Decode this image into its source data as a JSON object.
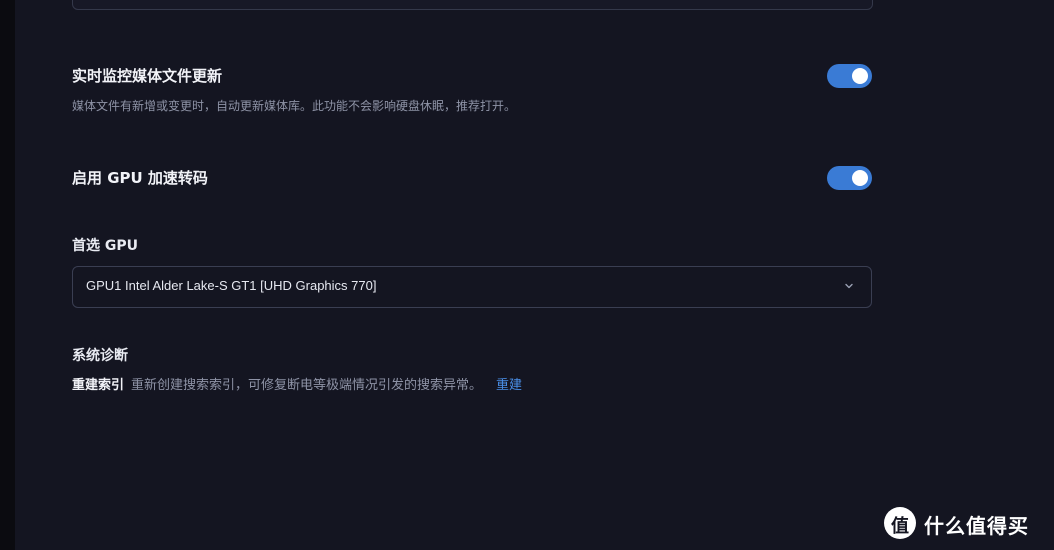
{
  "settings": {
    "monitor": {
      "title": "实时监控媒体文件更新",
      "description": "媒体文件有新增或变更时，自动更新媒体库。此功能不会影响硬盘休眠，推荐打开。",
      "enabled": true
    },
    "gpu_transcode": {
      "title": "启用 GPU 加速转码",
      "enabled": true
    },
    "preferred_gpu": {
      "label": "首选 GPU",
      "selected": "GPU1 Intel Alder Lake-S GT1 [UHD Graphics 770]"
    },
    "diagnostics": {
      "title": "系统诊断",
      "rebuild_label": "重建索引",
      "rebuild_desc": "重新创建搜索索引，可修复断电等极端情况引发的搜索异常。",
      "rebuild_action": "重建"
    }
  },
  "watermark": {
    "badge": "值",
    "text": "什么值得买"
  },
  "colors": {
    "background": "#141521",
    "accent": "#3a7bd5",
    "link": "#4a8fe8"
  }
}
